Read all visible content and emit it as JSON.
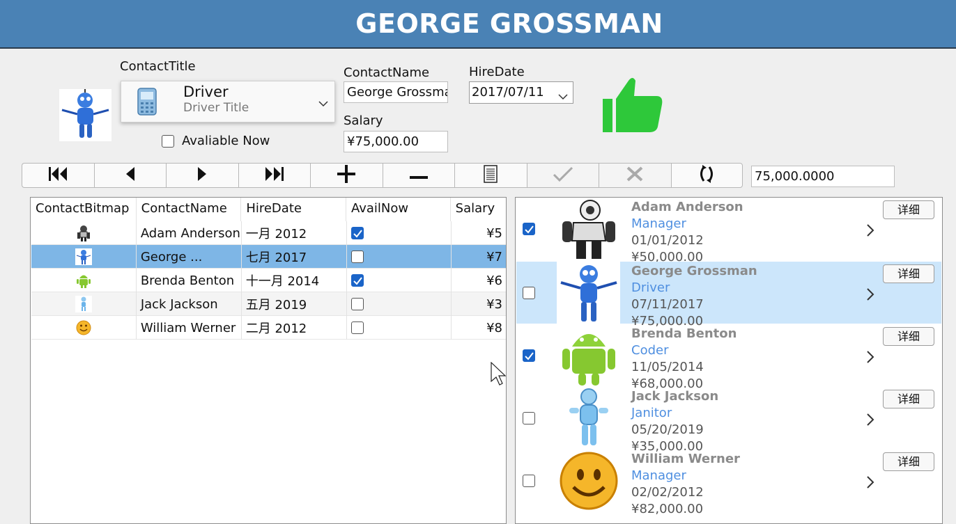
{
  "header": {
    "title": "GEORGE GROSSMAN",
    "bg_color": "#4a82b5"
  },
  "form": {
    "contact_title_label": "ContactTitle",
    "contact_title_value": "Driver",
    "contact_title_subtitle": "Driver Title",
    "available_now_label": "Avaliable Now",
    "available_now_checked": false,
    "contact_name_label": "ContactName",
    "contact_name_value": "George Grossman",
    "hire_date_label": "HireDate",
    "hire_date_value": "2017/07/11",
    "salary_label": "Salary",
    "salary_value": "¥75,000.00",
    "thumb_color": "#2ec83a"
  },
  "toolbar": {
    "buttons": [
      "first-icon",
      "previous-icon",
      "next-icon",
      "last-icon",
      "add-icon",
      "delete-icon",
      "edit-icon",
      "save-icon",
      "cancel-icon",
      "refresh-icon"
    ],
    "value_box": "75,000.0000"
  },
  "grid": {
    "columns": [
      "ContactBitmap",
      "ContactName",
      "HireDate",
      "AvailNow",
      "Salary"
    ],
    "rows": [
      {
        "name": "Adam Anderson",
        "hire": "一月 2012",
        "avail": true,
        "salary": "¥5"
      },
      {
        "name": "George ...",
        "hire": "七月 2017",
        "avail": false,
        "salary": "¥7"
      },
      {
        "name": "Brenda Benton",
        "hire": "十一月 2014",
        "avail": true,
        "salary": "¥6"
      },
      {
        "name": "Jack Jackson",
        "hire": "五月 2019",
        "avail": false,
        "salary": "¥3"
      },
      {
        "name": "William Werner",
        "hire": "二月 2012",
        "avail": false,
        "salary": "¥8"
      }
    ],
    "selected_color": "#7eb6e6"
  },
  "list": {
    "detail_label": "详细",
    "items": [
      {
        "name": "Adam Anderson",
        "title": "Manager",
        "date": "01/01/2012",
        "salary": "¥50,000.00",
        "checked": true
      },
      {
        "name": "George Grossman",
        "title": "Driver",
        "date": "07/11/2017",
        "salary": "¥75,000.00",
        "checked": false
      },
      {
        "name": "Brenda Benton",
        "title": "Coder",
        "date": "11/05/2014",
        "salary": "¥68,000.00",
        "checked": true
      },
      {
        "name": "Jack Jackson",
        "title": "Janitor",
        "date": "05/20/2019",
        "salary": "¥35,000.00",
        "checked": false
      },
      {
        "name": "William Werner",
        "title": "Manager",
        "date": "02/02/2012",
        "salary": "¥82,000.00",
        "checked": false
      }
    ],
    "selected_color": "#cce6fb",
    "title_color": "#4f8fe0"
  }
}
